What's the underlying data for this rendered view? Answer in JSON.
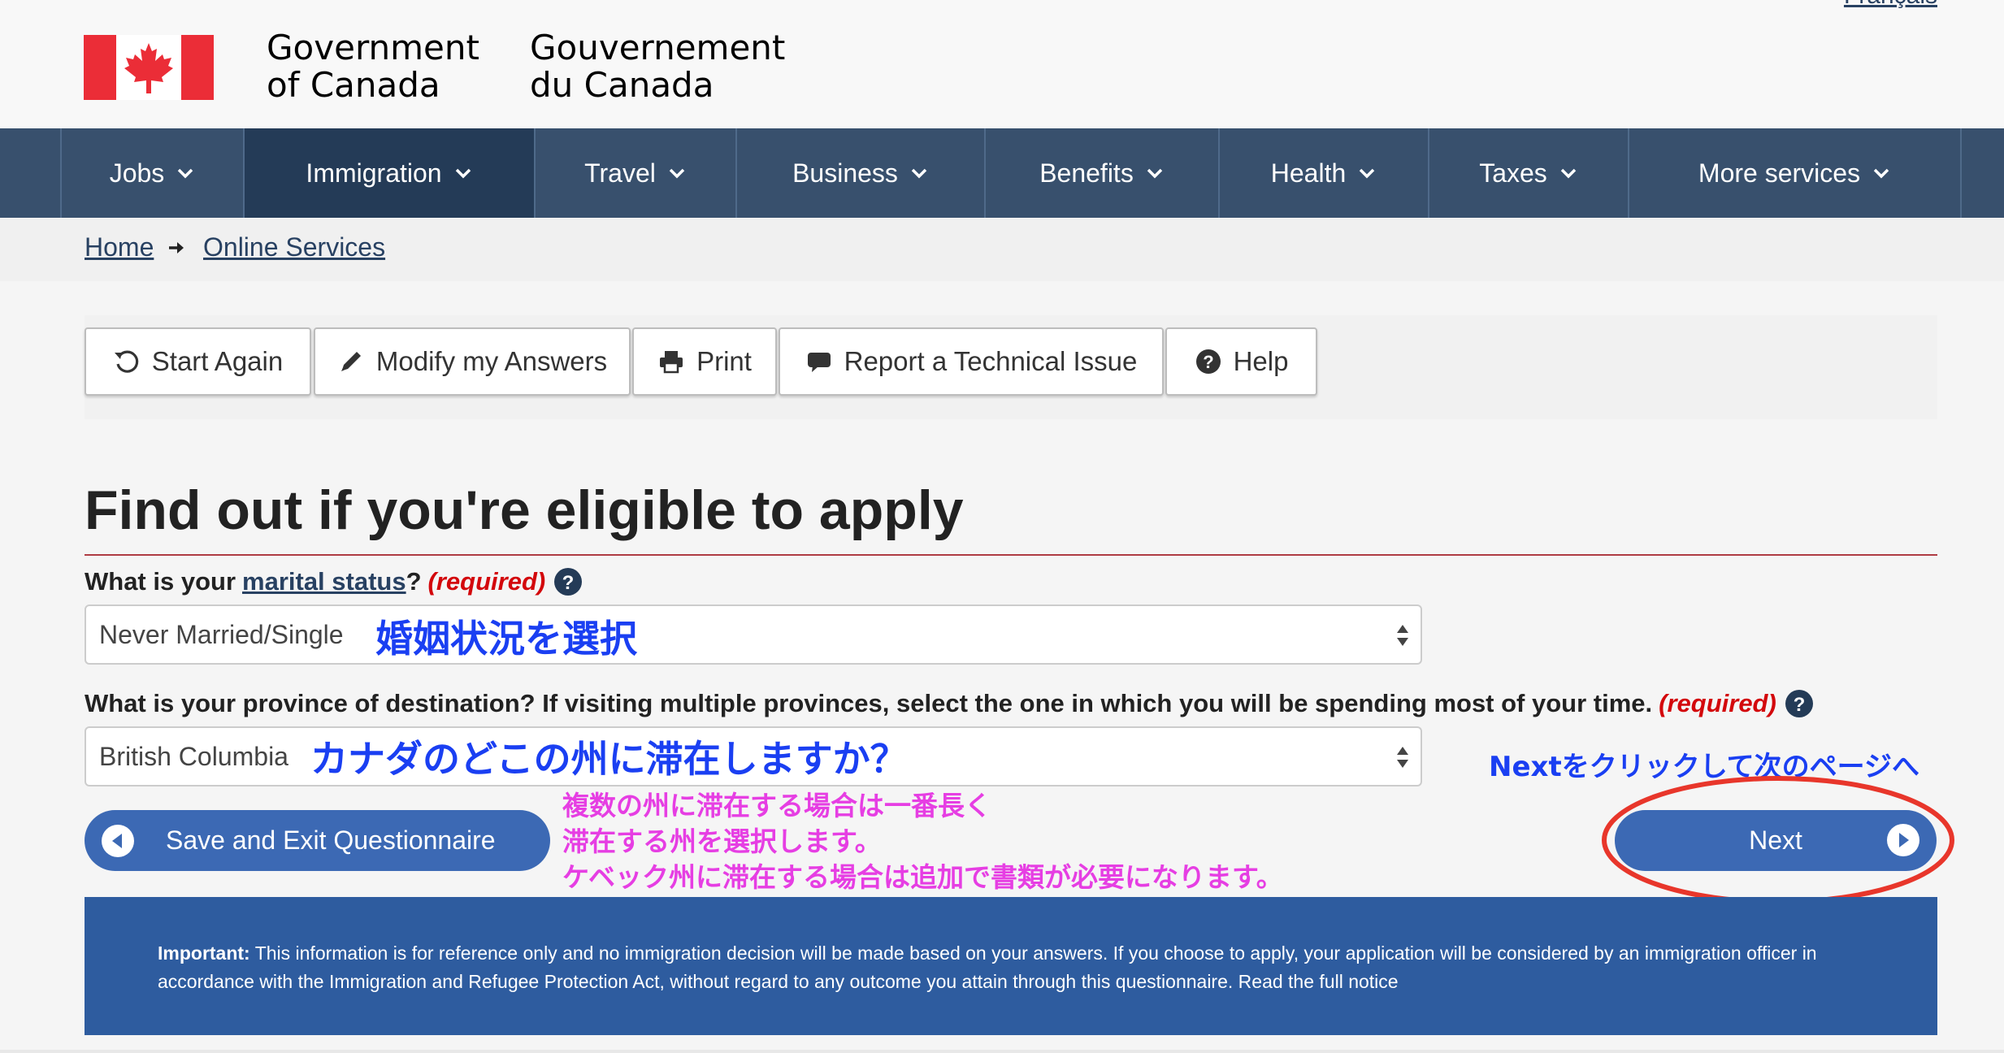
{
  "header": {
    "language_link": "Français",
    "signature_en": [
      "Government",
      "of Canada"
    ],
    "signature_fr": [
      "Gouvernement",
      "du Canada"
    ]
  },
  "nav": {
    "items": [
      {
        "label": "Jobs"
      },
      {
        "label": "Immigration",
        "active": true
      },
      {
        "label": "Travel"
      },
      {
        "label": "Business"
      },
      {
        "label": "Benefits"
      },
      {
        "label": "Health"
      },
      {
        "label": "Taxes"
      },
      {
        "label": "More services"
      }
    ]
  },
  "breadcrumb": {
    "items": [
      "Home",
      "Online Services"
    ]
  },
  "toolbar": {
    "start_again": "Start Again",
    "modify_answers": "Modify my Answers",
    "print": "Print",
    "report_issue": "Report a Technical Issue",
    "help": "Help"
  },
  "page": {
    "title": "Find out if you're eligible to apply"
  },
  "questions": {
    "marital": {
      "prefix": "What is your",
      "term": "marital status",
      "suffix": "?",
      "required": "(required)",
      "value": "Never Married/Single",
      "annotation": "婚姻状況を選択"
    },
    "province": {
      "label": "What is your province of destination? If visiting multiple provinces, select the one in which you will be spending most of your time.",
      "required": "(required)",
      "value": "British Columbia",
      "annotation": "カナダのどこの州に滞在しますか？"
    }
  },
  "annotations": {
    "next_hint": "Nextをクリックして次のページへ",
    "pink_lines": [
      "複数の州に滞在する場合は一番長く",
      "滞在する州を選択します。",
      "ケベック州に滞在する場合は追加で書類が必要になります。"
    ]
  },
  "buttons": {
    "save_exit": "Save and Exit Questionnaire",
    "next": "Next"
  },
  "notice": {
    "bold": "Important:",
    "text": " This information is for reference only and no immigration decision will be made based on your answers. If you choose to apply, your application will be considered by an immigration officer in accordance with the Immigration and Refugee Protection Act, without regard to any outcome you attain through this questionnaire. ",
    "link": "Read the full notice"
  },
  "colors": {
    "nav_bg": "#38506d",
    "nav_active": "#243b57",
    "button_blue": "#3c69b4",
    "notice_blue": "#2e5c9f",
    "required_red": "#d3080c",
    "annotation_blue": "#1a3ff2",
    "annotation_pink": "#e63ee3",
    "flag_red": "#eb2d37"
  }
}
